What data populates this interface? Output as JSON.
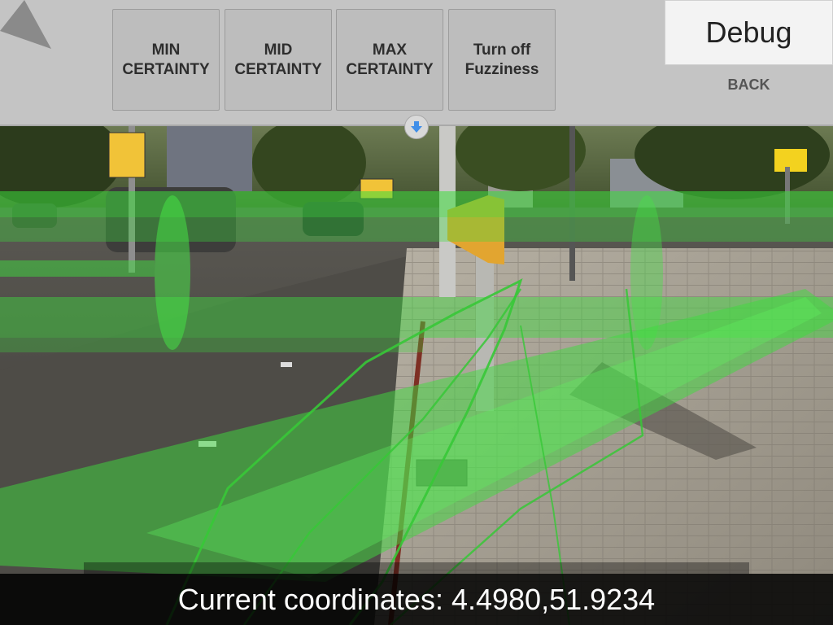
{
  "toolbar": {
    "buttons": [
      {
        "label": "MIN\nCERTAINTY"
      },
      {
        "label": "MID\nCERTAINTY"
      },
      {
        "label": "MAX\nCERTAINTY"
      },
      {
        "label": "Turn off\nFuzziness"
      }
    ],
    "debug_label": "Debug",
    "back_label": "BACK"
  },
  "footer": {
    "coordinates_label": "Current coordinates: 4.4980,51.9234"
  },
  "colors": {
    "toolbar_bg": "#c4c4c4",
    "button_bg": "#bdbdbd",
    "overlay_green": "#3ddc3d",
    "coord_bar_bg": "#000000"
  },
  "icons": {
    "nav": "navigation-arrow-icon",
    "collapse": "arrow-down-icon"
  }
}
